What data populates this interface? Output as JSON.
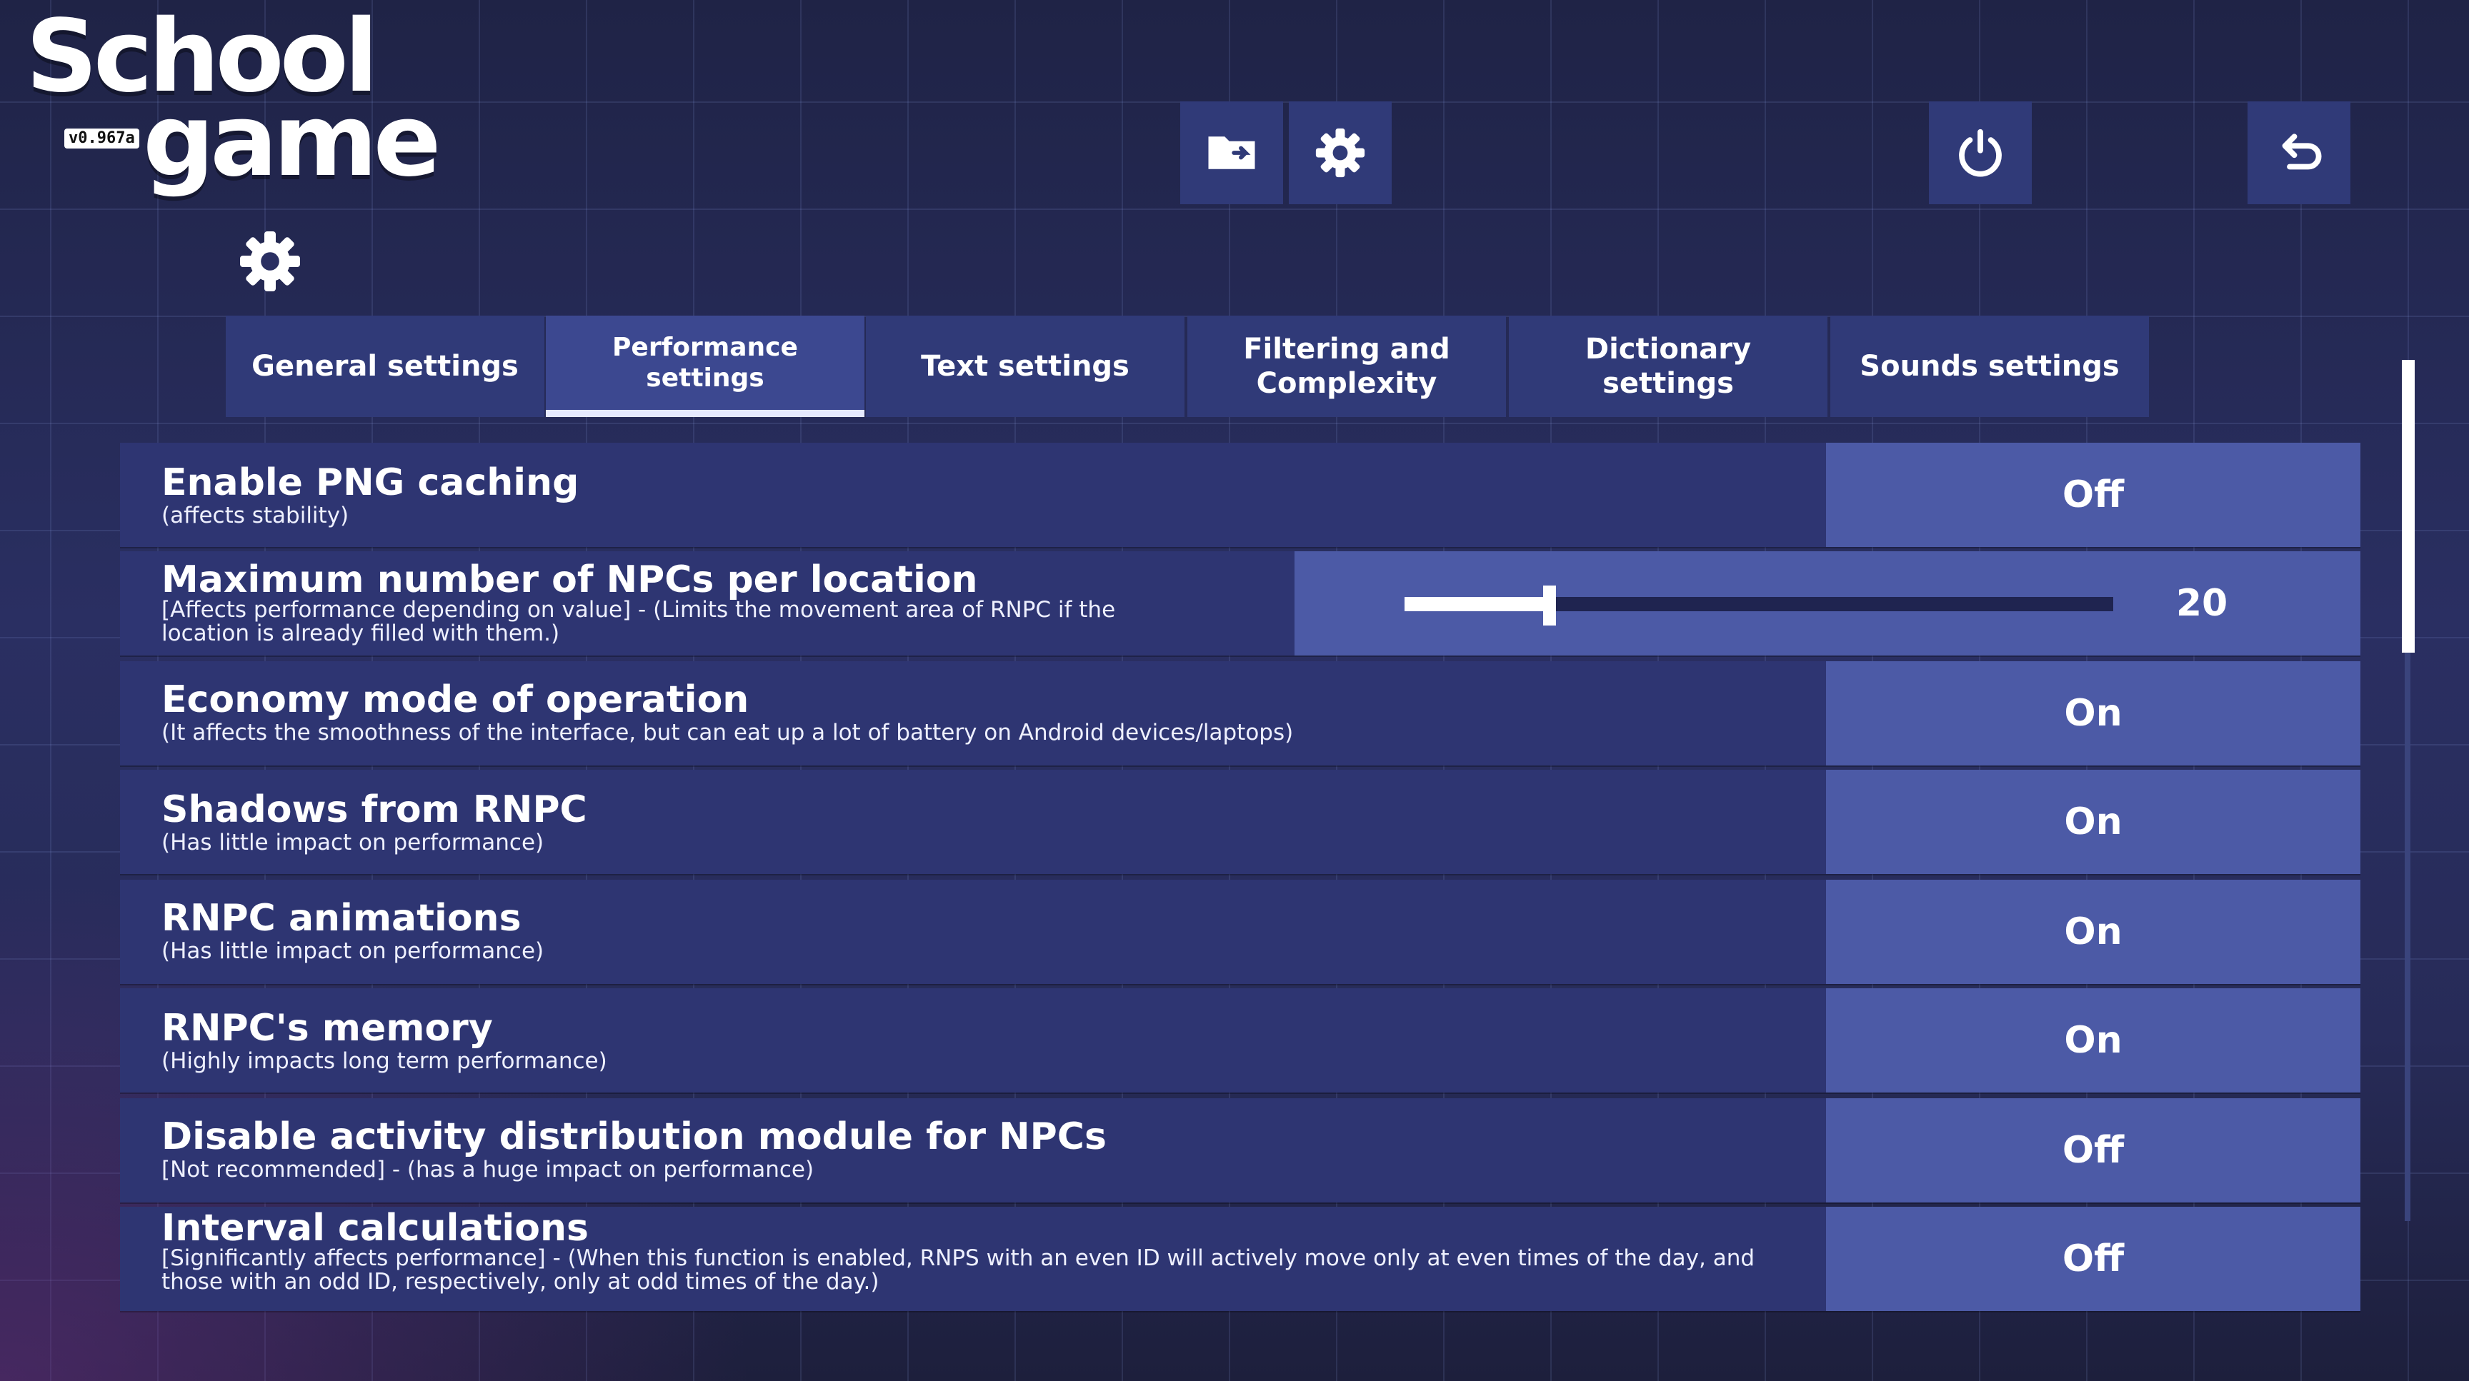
{
  "logo": {
    "line1": "School",
    "line2": "game",
    "version": "v0.967a"
  },
  "toolbar": {
    "folder_icon": "folder-arrow-icon",
    "settings_icon": "gear-icon",
    "power_icon": "power-icon",
    "back_icon": "undo-arrow-icon"
  },
  "section_icon": "gear-icon",
  "tabs": [
    {
      "label": "General settings",
      "active": false
    },
    {
      "label": "Performance settings",
      "active": true
    },
    {
      "label": "Text settings",
      "active": false
    },
    {
      "label": "Filtering and Complexity",
      "active": false
    },
    {
      "label": "Dictionary settings",
      "active": false
    },
    {
      "label": "Sounds settings",
      "active": false
    }
  ],
  "settings": [
    {
      "title": "Enable PNG caching",
      "description": "(affects stability)",
      "value": "Off"
    },
    {
      "title": "Maximum number of NPCs per location",
      "description": "[Affects performance depending on value] - (Limits the movement area of RNPC if the location is already filled with them.)",
      "value": "20",
      "slider_fraction": 0.205
    },
    {
      "title": "Economy mode of operation",
      "description": "(It affects the smoothness of the interface, but can eat up a lot of battery on Android devices/laptops)",
      "value": "On"
    },
    {
      "title": "Shadows from RNPC",
      "description": "(Has little impact on performance)",
      "value": "On"
    },
    {
      "title": "RNPC animations",
      "description": "(Has little impact on performance)",
      "value": "On"
    },
    {
      "title": "RNPC's memory",
      "description": "(Highly impacts long term performance)",
      "value": "On"
    },
    {
      "title": "Disable activity distribution module for NPCs",
      "description": "[Not recommended] - (has a huge impact on performance)",
      "value": "Off"
    },
    {
      "title": "Interval calculations",
      "description": "[Significantly affects performance] - (When this function is enabled, RNPS with an even ID will actively move only at even times of the day, and those with an odd ID, respectively, only at odd times of the day.)",
      "value": "Off"
    }
  ],
  "colors": {
    "panel": "#2e3572",
    "toggle": "#4c5aa6",
    "button": "#303a78",
    "text": "#ffffff"
  }
}
